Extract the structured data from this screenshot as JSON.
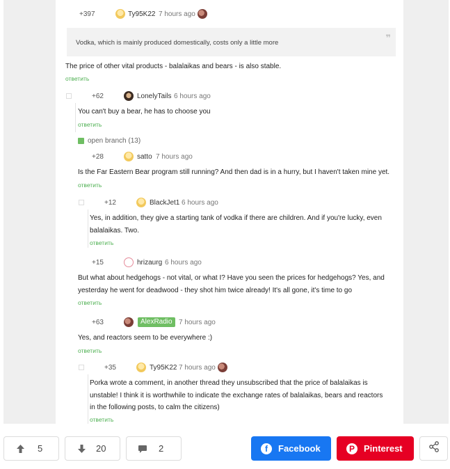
{
  "comments": [
    {
      "rating": "+397",
      "user": "Ty95K22",
      "time": "7 hours ago"
    },
    {
      "body": "The price of other vital products - balalaikas and bears - is also stable.",
      "reply": "ответить"
    },
    {
      "rating": "+62",
      "user": "LonelyTails",
      "time": "6 hours ago",
      "body": "You can't buy a bear, he has to choose you",
      "reply": "ответить"
    },
    {
      "rating": "+28",
      "user": "satto",
      "time": "7 hours ago",
      "body": "Is the Far Eastern Bear program still running? And then dad is in a hurry, but I haven't taken mine yet.",
      "reply": "ответить"
    },
    {
      "rating": "+12",
      "user": "BlackJet1",
      "time": "6 hours ago",
      "body": "Yes, in addition, they give a starting tank of vodka if there are children. And if you're lucky, even balalaikas. Two.",
      "reply": "ответить"
    },
    {
      "rating": "+15",
      "user": "hrizaurg",
      "time": "6 hours ago",
      "body": "But what about hedgehogs - not vital, or what I? Have you seen the prices for hedgehogs? Yes, and yesterday he went for deadwood - they shot him twice already! It's all gone, it's time to go",
      "reply": "ответить"
    },
    {
      "rating": "+63",
      "user": "AlexRadio",
      "time": "7 hours ago",
      "body": "Yes, and reactors seem to be everywhere :)",
      "reply": "ответить"
    },
    {
      "rating": "+35",
      "user": "Ty95K22",
      "time": "7 hours ago",
      "body": "Porka wrote a comment, in another thread they unsubscribed that the price of balalaikas is unstable! I think it is worthwhile to indicate the exchange rates of balalaikas, bears and reactors in the following posts, to calm the citizens)",
      "reply": "ответить"
    }
  ],
  "quote": {
    "text": "Vodka, which is mainly produced domestically, costs only a little more"
  },
  "branch": {
    "label": "open branch (13)"
  },
  "actions": {
    "upvotes": "5",
    "downvotes": "20",
    "comments": "2",
    "facebook_label": "Facebook",
    "pinterest_label": "Pinterest"
  },
  "colors": {
    "accent_green": "#6fbe63",
    "facebook": "#1877f2",
    "pinterest": "#e60023"
  },
  "icons": [
    "arrow-up-icon",
    "arrow-down-icon",
    "comment-icon",
    "facebook-icon",
    "pinterest-icon",
    "share-icon"
  ]
}
